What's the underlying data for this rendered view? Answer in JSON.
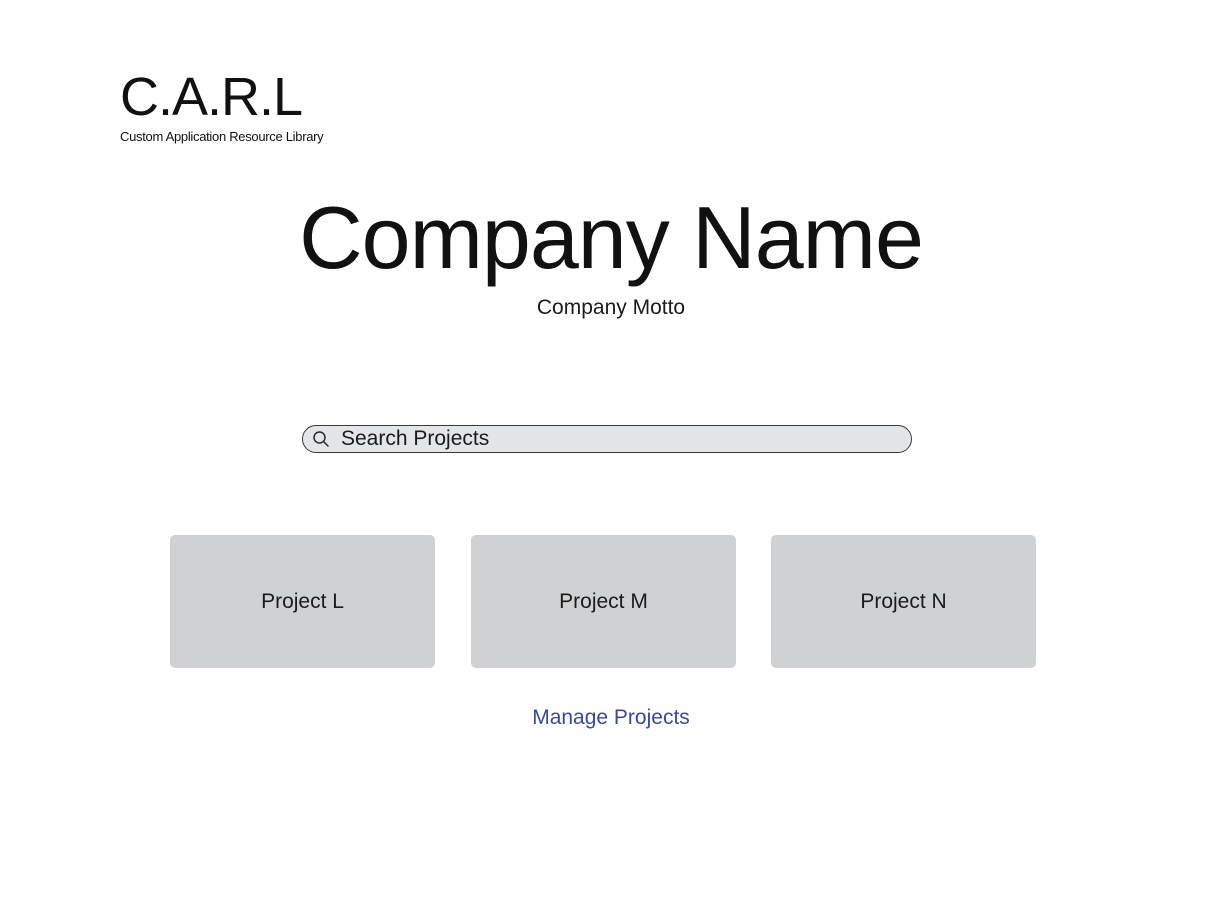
{
  "logo": {
    "mark": "C.A.R.L",
    "subtitle": "Custom Application Resource Library"
  },
  "hero": {
    "company_name": "Company Name",
    "company_motto": "Company Motto"
  },
  "search": {
    "placeholder": "Search Projects",
    "value": "",
    "icon": "search-icon"
  },
  "projects": [
    {
      "label": "Project L"
    },
    {
      "label": "Project M"
    },
    {
      "label": "Project N"
    }
  ],
  "manage_link": {
    "label": "Manage Projects"
  },
  "colors": {
    "background": "#ffffff",
    "text": "#111111",
    "card": "#d0d1d3",
    "search_bg": "#e4e5e7",
    "link": "#3a4a9a"
  }
}
